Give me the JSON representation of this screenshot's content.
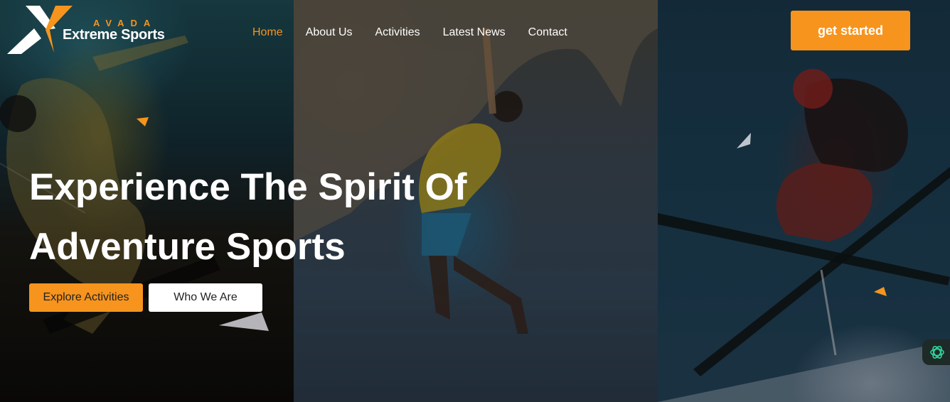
{
  "brand": {
    "top_line": "AVADA",
    "name": "Extreme Sports",
    "accent_color": "#f7941d",
    "logo_icon": "avada-x-logo-icon"
  },
  "nav": {
    "items": [
      {
        "label": "Home",
        "active": true
      },
      {
        "label": "About Us",
        "active": false
      },
      {
        "label": "Activities",
        "active": false
      },
      {
        "label": "Latest News",
        "active": false
      },
      {
        "label": "Contact",
        "active": false
      }
    ]
  },
  "header": {
    "cta_label": "get started"
  },
  "hero": {
    "headline_line1": "Experience The Spirit Of",
    "headline_line2": "Adventure Sports",
    "primary_button": "Explore Activities",
    "secondary_button": "Who We Are",
    "panels": [
      "skateboarder-photo",
      "rock-climber-photo",
      "skier-photo"
    ]
  },
  "widget": {
    "icon": "openai-assistant-icon"
  }
}
